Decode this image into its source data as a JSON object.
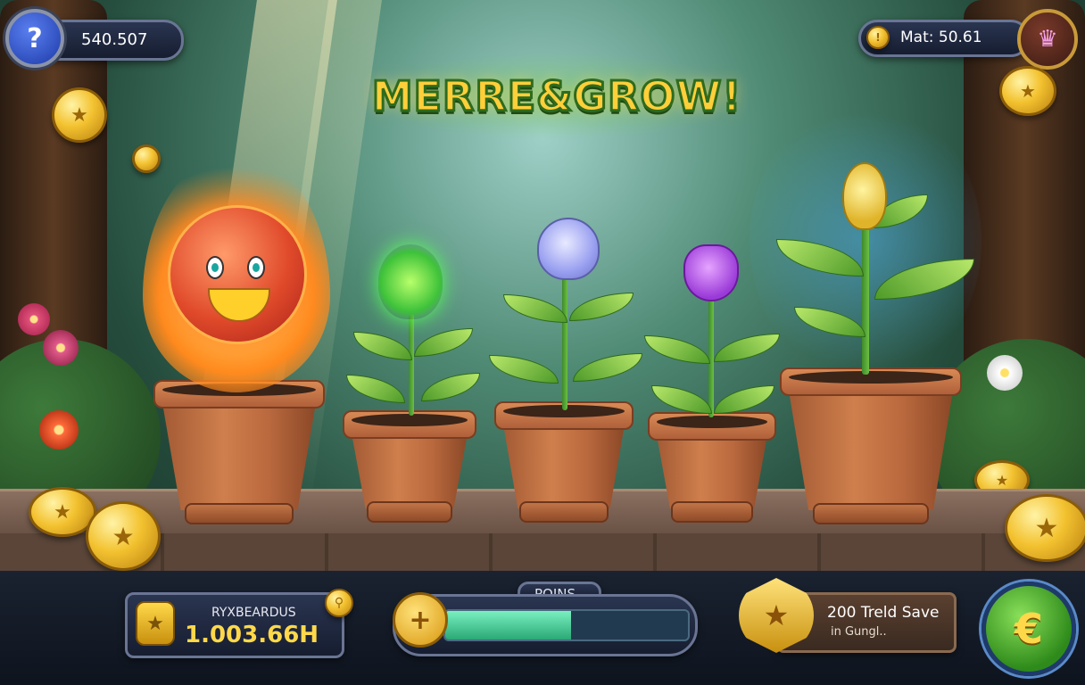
{
  "top_left": {
    "icon": "question-icon",
    "value": "540.507"
  },
  "top_right": {
    "icon": "coin-icon",
    "label": "Mat: 50.61",
    "badge_icon": "crown-icon"
  },
  "title": "MERRE&GROW!",
  "bottom": {
    "rewards": {
      "label": "RYXBEARDUS",
      "value": "1.003.66H",
      "icon": "star-shield-icon"
    },
    "points": {
      "label": "POINS",
      "progress": 0.52,
      "icon": "plus-icon"
    },
    "tree_save": {
      "line1": "200 Treld Save",
      "line2": "in Gungl.."
    },
    "currency_button": {
      "symbol": "€"
    }
  },
  "colors": {
    "accent_gold": "#f3c230",
    "panel": "#1a2230",
    "progress_fill": "#3fc48a"
  }
}
